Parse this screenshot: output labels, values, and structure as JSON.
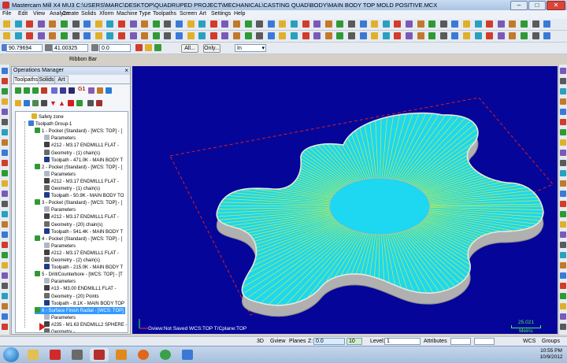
{
  "window": {
    "title": "Mastercam Mill X4 MU3  C:\\USERS\\MARC\\DESKTOP\\QUADRUPED PROJECT\\MECHANICAL\\CASTING QUAD\\BODY\\MAIN BODY TOP MOLD POSITIVE.MCX",
    "minimize": "–",
    "maximize": "□",
    "close": "✕"
  },
  "menu": [
    "File",
    "Edit",
    "View",
    "Analyze",
    "Create",
    "Solids",
    "Xform",
    "Machine Type",
    "Toolpaths",
    "Screen",
    "Art",
    "Settings",
    "Help"
  ],
  "ribbon": {
    "x_value": "90.79694",
    "y_value": "41.00325",
    "z_value": "0.0",
    "all_button": "All...",
    "only_button": "Only...",
    "mode_value": "In",
    "label": "Ribbon Bar"
  },
  "ops_manager": {
    "title": "Operations Manager",
    "tabs": [
      "Toolpaths",
      "Solids",
      "Art"
    ],
    "toolbar_ref": "G1",
    "tree": [
      {
        "text": "Safety zone",
        "level": 2,
        "icon": "safety-icon",
        "highlight": false
      },
      {
        "text": "Toolpath Group-1",
        "level": 1,
        "icon": "group-icon",
        "highlight": false
      },
      {
        "text": "1 - Pocket (Standard) - [WCS: TOP] - [",
        "level": 2,
        "icon": "operation-icon",
        "highlight": false
      },
      {
        "text": "Parameters",
        "level": 3,
        "icon": "parameters-icon",
        "highlight": false
      },
      {
        "text": "#212 - M3.17 ENDMILL1 FLAT -",
        "level": 3,
        "icon": "tool-icon",
        "highlight": false
      },
      {
        "text": "Geometry - (1) chain(s)",
        "level": 3,
        "icon": "geometry-icon",
        "highlight": false
      },
      {
        "text": "Toolpath - 471.0K - MAIN BODY T",
        "level": 3,
        "icon": "toolpath-icon",
        "highlight": false
      },
      {
        "text": "2 - Pocket (Standard) - [WCS: TOP] - [",
        "level": 2,
        "icon": "operation-icon",
        "highlight": false
      },
      {
        "text": "Parameters",
        "level": 3,
        "icon": "parameters-icon",
        "highlight": false
      },
      {
        "text": "#212 - M3.17 ENDMILL1 FLAT -",
        "level": 3,
        "icon": "tool-icon",
        "highlight": false
      },
      {
        "text": "Geometry - (1) chain(s)",
        "level": 3,
        "icon": "geometry-icon",
        "highlight": false
      },
      {
        "text": "Toolpath - 50.9K - MAIN BODY TO",
        "level": 3,
        "icon": "toolpath-icon",
        "highlight": false
      },
      {
        "text": "3 - Pocket (Standard) - [WCS: TOP] - [",
        "level": 2,
        "icon": "operation-icon",
        "highlight": false
      },
      {
        "text": "Parameters",
        "level": 3,
        "icon": "parameters-icon",
        "highlight": false
      },
      {
        "text": "#212 - M3.17 ENDMILL1 FLAT -",
        "level": 3,
        "icon": "tool-icon",
        "highlight": false
      },
      {
        "text": "Geometry - (20) chain(s)",
        "level": 3,
        "icon": "geometry-icon",
        "highlight": false
      },
      {
        "text": "Toolpath - 541.4K - MAIN BODY T",
        "level": 3,
        "icon": "toolpath-icon",
        "highlight": false
      },
      {
        "text": "4 - Pocket (Standard) - [WCS: TOP] - [",
        "level": 2,
        "icon": "operation-icon",
        "highlight": false
      },
      {
        "text": "Parameters",
        "level": 3,
        "icon": "parameters-icon",
        "highlight": false
      },
      {
        "text": "#212 - M3.17 ENDMILL1 FLAT -",
        "level": 3,
        "icon": "tool-icon",
        "highlight": false
      },
      {
        "text": "Geometry - (2) chain(s)",
        "level": 3,
        "icon": "geometry-icon",
        "highlight": false
      },
      {
        "text": "Toolpath - 215.0K - MAIN BODY T",
        "level": 3,
        "icon": "toolpath-icon",
        "highlight": false
      },
      {
        "text": "5 - Drill/Counterbore - [WCS: TOP] - [T",
        "level": 2,
        "icon": "operation-icon",
        "highlight": false
      },
      {
        "text": "Parameters",
        "level": 3,
        "icon": "parameters-icon",
        "highlight": false
      },
      {
        "text": "#13 - M3.00 ENDMILL1 FLAT -",
        "level": 3,
        "icon": "tool-icon",
        "highlight": false
      },
      {
        "text": "Geometry - (20) Points",
        "level": 3,
        "icon": "geometry-icon",
        "highlight": false
      },
      {
        "text": "Toolpath - 8.1K - MAIN BODY TOP",
        "level": 3,
        "icon": "toolpath-icon",
        "highlight": false
      },
      {
        "text": "6 - Surface Finish Radial - [WCS: TOP]",
        "level": 2,
        "icon": "operation-icon",
        "highlight": true
      },
      {
        "text": "Parameters",
        "level": 3,
        "icon": "parameters-icon",
        "highlight": false
      },
      {
        "text": "#235 - M1.63 ENDMILL2 SPHERE -",
        "level": 3,
        "icon": "tool-icon",
        "highlight": false
      },
      {
        "text": "Geometry -",
        "level": 3,
        "icon": "geometry-icon",
        "highlight": false
      },
      {
        "text": "Toolpath - 2520.6K - MAIN BODY T",
        "level": 3,
        "icon": "toolpath-icon",
        "highlight": false
      }
    ]
  },
  "viewport": {
    "status": "Gview:Not Saved   WCS:TOP   T/Cplane:TOP",
    "scale_value": "25.021",
    "scale_unit": "Metric",
    "background_color": "#05059a",
    "part_fill_color": "#1ed7f0",
    "toolpath_color": "#f2f21c",
    "boundary_color": "#d61e1e"
  },
  "statusbar": {
    "mode": "3D",
    "gview": "Gview",
    "planes": "Planes",
    "z_label": "Z:",
    "z_value": "0.0",
    "color_value": "10",
    "level_label": "Level:",
    "level_value": "1",
    "attributes": "Attributes",
    "wcs": "WCS",
    "groups": "Groups"
  },
  "taskbar": {
    "time": "10:55 PM",
    "date": "10/9/2012",
    "apps": [
      "explorer-icon",
      "solidworks-icon",
      "xsi-icon",
      "mastercam-icon",
      "media-player-icon",
      "firefox-icon",
      "chrome-icon",
      "paint-icon"
    ]
  }
}
